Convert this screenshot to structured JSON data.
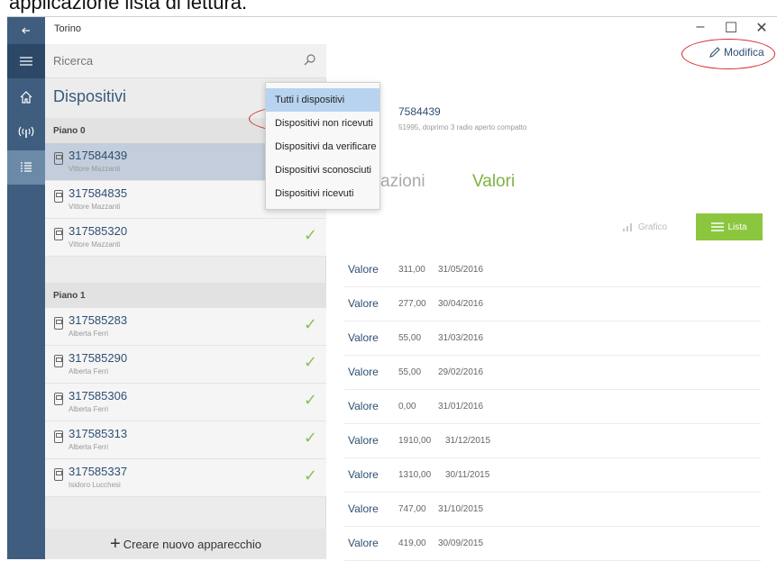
{
  "caption": "applicazione lista di lettura.",
  "app_title": "Torino",
  "window_controls": {
    "minimize": "–",
    "maximize": "☐",
    "close": "✕"
  },
  "search": {
    "placeholder": "Ricerca"
  },
  "panel_title": "Dispositivi",
  "sections": [
    {
      "label": "Piano 0"
    },
    {
      "label": "Piano 1"
    }
  ],
  "devices_piano0": [
    {
      "num": "317584439",
      "owner": "Vittore Mazzanti",
      "check": ""
    },
    {
      "num": "317584835",
      "owner": "Vittore Mazzanti",
      "check": "✓"
    },
    {
      "num": "317585320",
      "owner": "Vittore Mazzanti",
      "check": "✓"
    }
  ],
  "devices_piano1": [
    {
      "num": "317585283",
      "owner": "Alberta Ferri",
      "check": "✓"
    },
    {
      "num": "317585290",
      "owner": "Alberta Ferri",
      "check": "✓"
    },
    {
      "num": "317585306",
      "owner": "Alberta Ferri",
      "check": "✓"
    },
    {
      "num": "317585313",
      "owner": "Alberta Ferri",
      "check": "✓"
    },
    {
      "num": "317585337",
      "owner": "Isidoro Lucchesi",
      "check": "✓"
    }
  ],
  "add_button": {
    "plus": "+",
    "label": "Creare nuovo apparecchio"
  },
  "filter_menu": [
    {
      "label": "Tutti i dispositivi",
      "active": true
    },
    {
      "label": "Dispositivi non ricevuti",
      "active": false
    },
    {
      "label": "Dispositivi da verificare",
      "active": false
    },
    {
      "label": "Dispositivi sconosciuti",
      "active": false
    },
    {
      "label": "Dispositivi ricevuti",
      "active": false
    }
  ],
  "detail": {
    "device_num": "7584439",
    "device_desc": "51995, doprimo 3 radio aperto compatto",
    "tab_prev": "azioni",
    "tab_active": "Valori",
    "btn_grafico": "Grafico",
    "btn_lista": "Lista",
    "modifica": "Modifica"
  },
  "values": [
    {
      "label": "Valore",
      "value": "311,00",
      "date": "31/05/2016"
    },
    {
      "label": "Valore",
      "value": "277,00",
      "date": "30/04/2016"
    },
    {
      "label": "Valore",
      "value": "55,00",
      "date": "31/03/2016"
    },
    {
      "label": "Valore",
      "value": "55,00",
      "date": "29/02/2016"
    },
    {
      "label": "Valore",
      "value": "0,00",
      "date": "31/01/2016"
    },
    {
      "label": "Valore",
      "value": "1910,00",
      "date": "31/12/2015"
    },
    {
      "label": "Valore",
      "value": "1310,00",
      "date": "30/11/2015"
    },
    {
      "label": "Valore",
      "value": "747,00",
      "date": "31/10/2015"
    },
    {
      "label": "Valore",
      "value": "419,00",
      "date": "30/09/2015"
    }
  ],
  "colors": {
    "rail": "#3f5d7e",
    "accent": "#8cc63f",
    "highlight_ellipse": "#d42a2a"
  }
}
